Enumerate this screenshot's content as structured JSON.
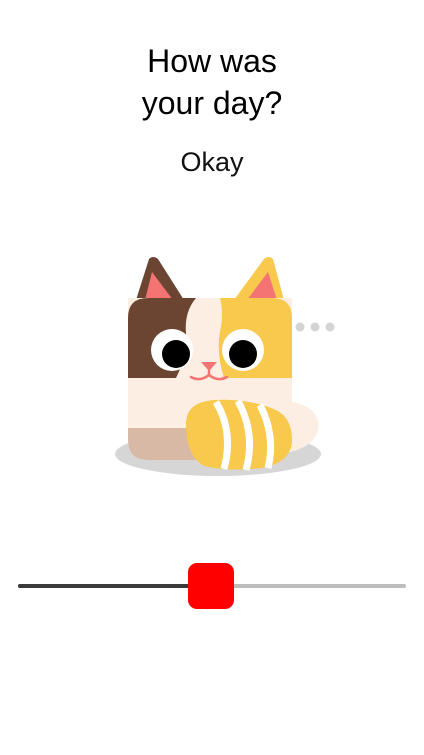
{
  "question": {
    "line1": "How was",
    "line2": "your day?"
  },
  "mood": {
    "label": "Okay",
    "illustration": "calico-cat-icon"
  },
  "slider": {
    "value_fraction": 0.497,
    "fill_color": "#3a3a3a",
    "track_color": "#bdbdbd",
    "thumb_color": "#ff0000"
  }
}
